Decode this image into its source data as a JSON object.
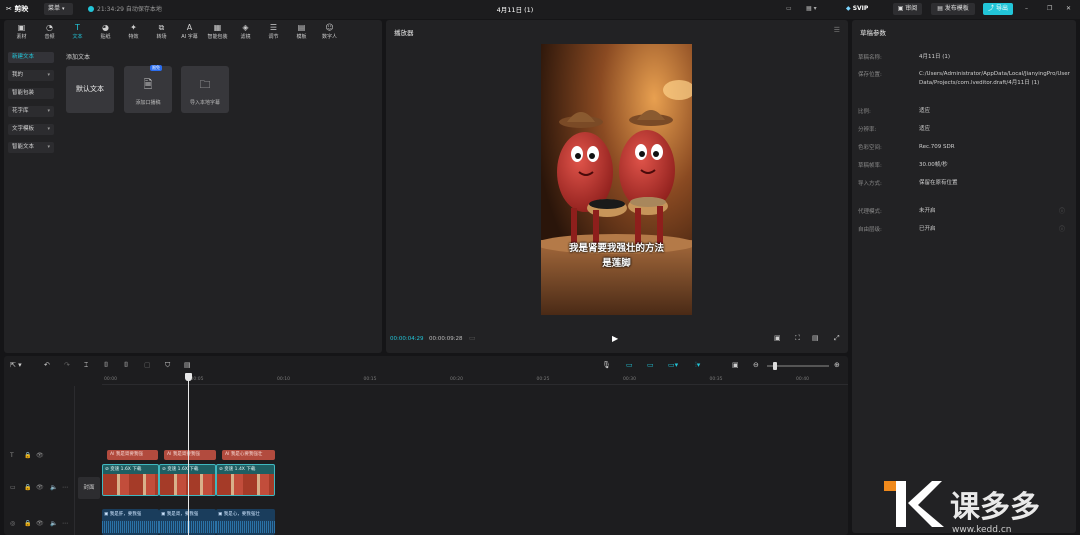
{
  "titlebar": {
    "app_name": "剪映",
    "menu_label": "菜单",
    "save_status": "21:34:29 自动保存本地",
    "project_title": "4月11日 (1)",
    "svip_label": "SVIP",
    "review_label": "审阅",
    "publish_template_label": "发布模板",
    "export_label": "导出"
  },
  "toolbar": {
    "tools": [
      {
        "label": "素材",
        "icon": "media-icon"
      },
      {
        "label": "音频",
        "icon": "audio-icon"
      },
      {
        "label": "文本",
        "icon": "text-icon",
        "active": true
      },
      {
        "label": "贴纸",
        "icon": "sticker-icon"
      },
      {
        "label": "特效",
        "icon": "effects-icon"
      },
      {
        "label": "转场",
        "icon": "transition-icon"
      },
      {
        "label": "AI 字幕",
        "icon": "ai-caption-icon"
      },
      {
        "label": "智能包装",
        "icon": "smart-pack-icon"
      },
      {
        "label": "滤镜",
        "icon": "filter-icon"
      },
      {
        "label": "调节",
        "icon": "adjust-icon"
      },
      {
        "label": "模板",
        "icon": "template-icon"
      },
      {
        "label": "数字人",
        "icon": "avatar-icon"
      }
    ]
  },
  "text_panel": {
    "categories": [
      {
        "label": "新建文本",
        "active": true,
        "dropdown": false
      },
      {
        "label": "我的",
        "dropdown": true
      },
      {
        "label": "智能包装",
        "dropdown": false
      },
      {
        "label": "花字库",
        "dropdown": true
      },
      {
        "label": "文字模板",
        "dropdown": true
      },
      {
        "label": "智能文本",
        "dropdown": true
      }
    ],
    "section_title": "添加文本",
    "tiles": {
      "default_text": "默认文本",
      "script_label": "添加口播稿",
      "script_badge": "限免",
      "import_subtitle": "导入本地字幕"
    }
  },
  "player": {
    "title": "播放器",
    "subtitle_line1": "我是肾要我强壮的方法",
    "subtitle_line2": "是莲脚",
    "current_time": "00:00:04:29",
    "total_time": "00:00:09:28"
  },
  "props": {
    "title": "草稿参数",
    "rows": [
      {
        "label": "草稿名称:",
        "value": "4月11日 (1)"
      },
      {
        "label": "保存位置:",
        "value": "C:/Users/Administrator/AppData/Local/JianyingPro/User Data/Projects/com.lveditor.draft/4月11日 (1)"
      },
      {
        "label": "比例:",
        "value": "适应"
      },
      {
        "label": "分辨率:",
        "value": "适应"
      },
      {
        "label": "色彩空间:",
        "value": "Rec.709 SDR"
      },
      {
        "label": "草稿帧率:",
        "value": "30.00帧/秒"
      },
      {
        "label": "导入方式:",
        "value": "保留在原有位置"
      },
      {
        "label": "代理模式:",
        "value": "未开启"
      },
      {
        "label": "自由层级:",
        "value": "已开启"
      }
    ]
  },
  "timeline": {
    "ruler_ticks": [
      "00:00",
      "00:05",
      "00:10",
      "00:15",
      "00:20",
      "00:25",
      "00:30",
      "00:35",
      "00:40"
    ],
    "cover_label": "封面",
    "text_clips": [
      "AI 我是肾要我强",
      "AI 我是肾要我强",
      "AI 我是心要我强壮"
    ],
    "video_clips": [
      {
        "speed": "变速 1.6X",
        "tag": "下载"
      },
      {
        "speed": "变速 1.6X",
        "tag": "下载"
      },
      {
        "speed": "变速 1.4X",
        "tag": "下载"
      }
    ],
    "audio_clips": [
      "我是肝，要我强",
      "我是肾，要我强",
      "我是心，要我强壮"
    ]
  },
  "watermark": {
    "brand": "课多多",
    "url": "www.kedd.cn"
  },
  "colors": {
    "accent": "#22c5d8",
    "text_clip": "#b24b3e",
    "video_clip": "#1f5e62",
    "audio_clip": "#1a3d5c",
    "export_button": "#22c5d8"
  }
}
